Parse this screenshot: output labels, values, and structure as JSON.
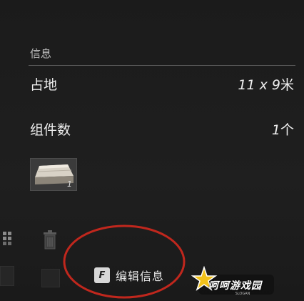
{
  "info_panel": {
    "section_title": "信息",
    "rows": [
      {
        "label": "占地",
        "value": "11 x 9",
        "unit": "米"
      },
      {
        "label": "组件数",
        "value": "1",
        "unit": "个"
      }
    ],
    "components": [
      {
        "icon": "wood-plank-block-icon",
        "count": "1"
      }
    ]
  },
  "toolbar": {
    "edit_key": "F",
    "edit_label": "编辑信息"
  },
  "side_icons": [
    "grid-icon",
    "trash-icon"
  ],
  "annotation": {
    "shape": "ellipse",
    "color": "#c0271d"
  },
  "watermark": {
    "text": "呵呵游戏园",
    "sub": "SLOGAN",
    "star_color": "#f2c21a"
  }
}
